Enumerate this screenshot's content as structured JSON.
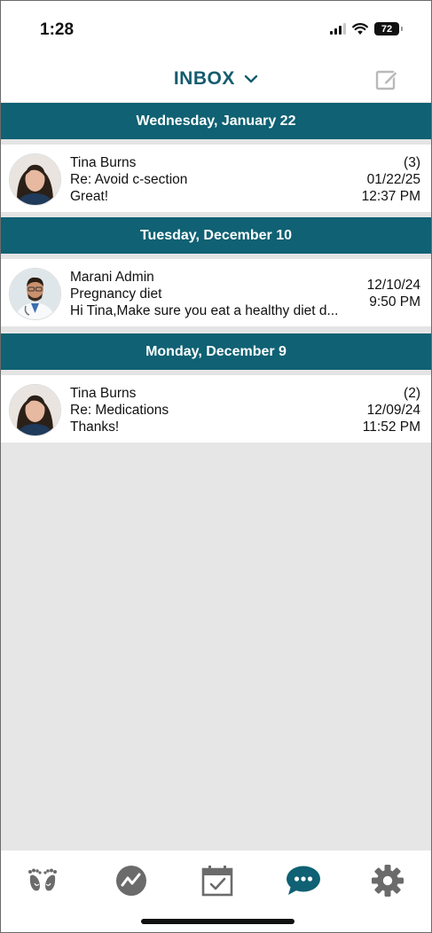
{
  "status_bar": {
    "time": "1:28",
    "battery": "72"
  },
  "header": {
    "title": "INBOX"
  },
  "groups": [
    {
      "date": "Wednesday, January 22",
      "messages": [
        {
          "sender": "Tina Burns",
          "subject": "Re: Avoid c-section",
          "preview": "Great!",
          "count": "(3)",
          "date": "01/22/25",
          "time": "12:37 PM"
        }
      ]
    },
    {
      "date": "Tuesday, December 10",
      "messages": [
        {
          "sender": "Marani Admin",
          "subject": "Pregnancy diet",
          "preview": "Hi Tina,Make sure you eat a healthy diet d...",
          "date": "12/10/24",
          "time": "9:50 PM"
        }
      ]
    },
    {
      "date": "Monday, December 9",
      "messages": [
        {
          "sender": "Tina Burns",
          "subject": "Re: Medications",
          "preview": "Thanks!",
          "count": "(2)",
          "date": "12/09/24",
          "time": "11:52 PM"
        }
      ]
    }
  ],
  "tab_bar": {
    "items": [
      {
        "icon": "footprints-icon",
        "active": false
      },
      {
        "icon": "trend-chart-icon",
        "active": false
      },
      {
        "icon": "calendar-check-icon",
        "active": false
      },
      {
        "icon": "chat-bubble-icon",
        "active": true
      },
      {
        "icon": "gear-icon",
        "active": false
      }
    ]
  },
  "colors": {
    "accent": "#0f6173",
    "title": "#155c6e",
    "tab_inactive": "#6b6b6b",
    "background": "#e6e6e6"
  }
}
